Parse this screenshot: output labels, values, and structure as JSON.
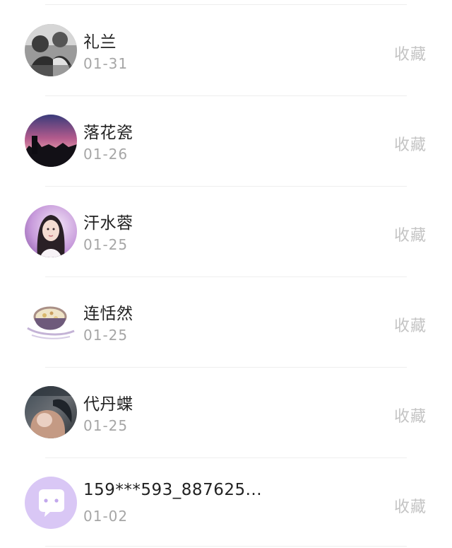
{
  "contacts": [
    {
      "name": "礼兰",
      "date": "01-31",
      "action": "收藏",
      "avatar_icon": "couple-photo-avatar-icon"
    },
    {
      "name": "落花瓷",
      "date": "01-26",
      "action": "收藏",
      "avatar_icon": "sunset-city-avatar-icon"
    },
    {
      "name": "汗水蓉",
      "date": "01-25",
      "action": "收藏",
      "avatar_icon": "costume-girl-avatar-icon"
    },
    {
      "name": "连恬然",
      "date": "01-25",
      "action": "收藏",
      "avatar_icon": "pottery-bowl-avatar-icon"
    },
    {
      "name": "代丹蝶",
      "date": "01-25",
      "action": "收藏",
      "avatar_icon": "portrait-photo-avatar-icon"
    },
    {
      "name": "159***593_887625...",
      "date": "01-02",
      "action": "收藏",
      "avatar_icon": "default-chat-avatar-icon"
    }
  ],
  "colors": {
    "name_text": "#222222",
    "date_text": "#a6a6a6",
    "action_text": "#c4c4c4",
    "divider": "#eeeeee",
    "default_avatar": "#d9c7f5"
  }
}
